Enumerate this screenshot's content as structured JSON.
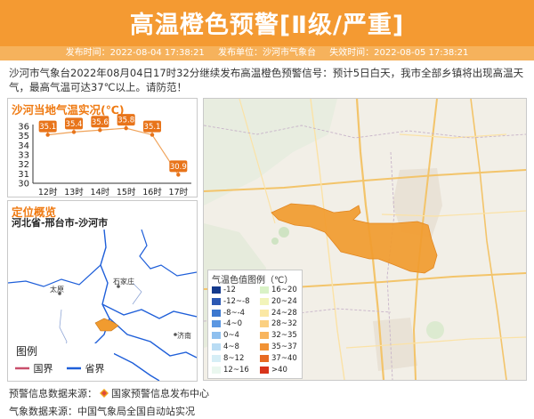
{
  "header": {
    "title": "高温橙色预警[Ⅱ级/严重]",
    "publish_time": "发布时间：2022-08-04 17:38:21",
    "publisher": "发布单位：沙河市气象台",
    "expire_time": "失效时间：2022-08-05 17:38:21"
  },
  "description": "沙河市气象台2022年08月04日17时32分继续发布高温橙色预警信号：预计5日白天，我市全部乡镇将出现高温天气，最高气温可达37℃以上。请防范！",
  "temp_panel": {
    "title": "沙河当地气温实况(℃)"
  },
  "location_panel": {
    "title": "定位概览",
    "region": "河北省-邢台市-沙河市"
  },
  "minimap": {
    "labels": {
      "shijiazhuang": "石家庄",
      "taiyuan": "太原",
      "jinan": "济南"
    },
    "legend_title": "图例",
    "legend_items": [
      {
        "label": "国界",
        "color": "#c94f6b"
      },
      {
        "label": "省界",
        "color": "#1f5fd9"
      }
    ]
  },
  "temp_legend": {
    "title": "气温色值图例（℃）",
    "items": [
      {
        "label": "-12",
        "color": "#143a8c"
      },
      {
        "label": "-12~-8",
        "color": "#2b58b3"
      },
      {
        "label": "-8~-4",
        "color": "#3c78cf"
      },
      {
        "label": "-4~0",
        "color": "#5b97e2"
      },
      {
        "label": "0~4",
        "color": "#8fc0ef"
      },
      {
        "label": "4~8",
        "color": "#b9dcf4"
      },
      {
        "label": "8~12",
        "color": "#d6eef6"
      },
      {
        "label": "12~16",
        "color": "#eaf7ef"
      },
      {
        "label": "16~20",
        "color": "#d9f2c6"
      },
      {
        "label": "20~24",
        "color": "#f2f4ba"
      },
      {
        "label": "24~28",
        "color": "#fbe8a4"
      },
      {
        "label": "28~32",
        "color": "#fbd081"
      },
      {
        "label": "32~35",
        "color": "#f8b55e"
      },
      {
        "label": "35~37",
        "color": "#f19234"
      },
      {
        "label": "37~40",
        "color": "#e76a22"
      },
      {
        "label": ">40",
        "color": "#d8341a"
      }
    ]
  },
  "sources": {
    "warning": "预警信息数据来源：",
    "warning_org": "国家预警信息发布中心",
    "weather": "气象数据来源：中国气象局全国自动站实况"
  },
  "colors": {
    "accent": "#f49a32",
    "warning_area": "#f19b2f",
    "marker": "#e8741a"
  },
  "chart_data": {
    "type": "line",
    "title": "沙河当地气温实况(℃)",
    "categories": [
      "12时",
      "13时",
      "14时",
      "15时",
      "16时",
      "17时"
    ],
    "values": [
      35.1,
      35.4,
      35.6,
      35.8,
      35.1,
      30.9
    ],
    "data_labels": [
      "35.1",
      "35.4",
      "35.6",
      "35.8",
      "35.1",
      "30.9"
    ],
    "yticks": [
      "36",
      "35",
      "34",
      "33",
      "32",
      "31",
      "30"
    ],
    "ylim": [
      30,
      36
    ],
    "grid": false
  }
}
